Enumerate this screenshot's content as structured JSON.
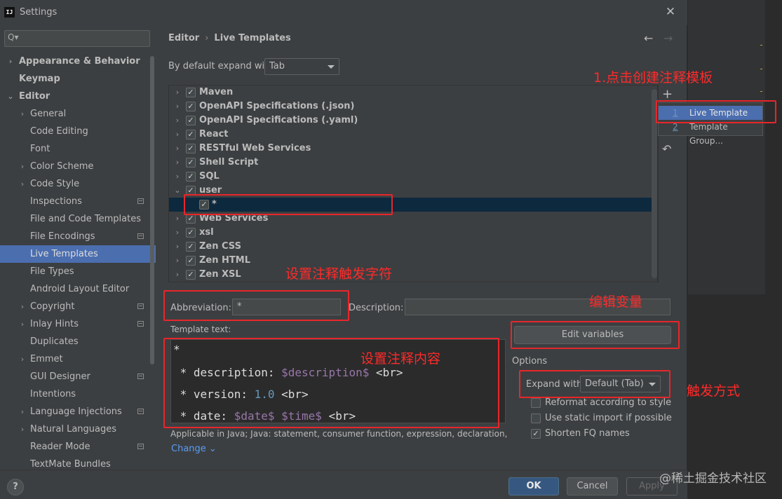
{
  "window": {
    "title": "Settings",
    "app_icon": "IJ"
  },
  "search": {
    "placeholder": ""
  },
  "sidebar": {
    "items": [
      {
        "label": "Appearance & Behavior"
      },
      {
        "label": "Keymap"
      },
      {
        "label": "Editor"
      },
      {
        "label": "General"
      },
      {
        "label": "Code Editing"
      },
      {
        "label": "Font"
      },
      {
        "label": "Color Scheme"
      },
      {
        "label": "Code Style"
      },
      {
        "label": "Inspections"
      },
      {
        "label": "File and Code Templates"
      },
      {
        "label": "File Encodings"
      },
      {
        "label": "Live Templates"
      },
      {
        "label": "File Types"
      },
      {
        "label": "Android Layout Editor"
      },
      {
        "label": "Copyright"
      },
      {
        "label": "Inlay Hints"
      },
      {
        "label": "Duplicates"
      },
      {
        "label": "Emmet"
      },
      {
        "label": "GUI Designer"
      },
      {
        "label": "Intentions"
      },
      {
        "label": "Language Injections"
      },
      {
        "label": "Natural Languages"
      },
      {
        "label": "Reader Mode"
      },
      {
        "label": "TextMate Bundles"
      }
    ],
    "selected": "Live Templates"
  },
  "breadcrumb": {
    "parent": "Editor",
    "separator": "›",
    "current": "Live Templates"
  },
  "nav": {
    "back": "←",
    "forward": "→"
  },
  "expand_default": {
    "label": "By default expand with",
    "value": "Tab"
  },
  "tree": {
    "groups": [
      {
        "label": "Maven",
        "checked": true
      },
      {
        "label": "OpenAPI Specifications (.json)",
        "checked": true
      },
      {
        "label": "OpenAPI Specifications (.yaml)",
        "checked": true
      },
      {
        "label": "React",
        "checked": true
      },
      {
        "label": "RESTful Web Services",
        "checked": true
      },
      {
        "label": "Shell Script",
        "checked": true
      },
      {
        "label": "SQL",
        "checked": true
      },
      {
        "label": "user",
        "checked": true
      },
      {
        "label": "*",
        "checked": true
      },
      {
        "label": "Web Services",
        "checked": true
      },
      {
        "label": "xsl",
        "checked": true
      },
      {
        "label": "Zen CSS",
        "checked": true
      },
      {
        "label": "Zen HTML",
        "checked": true
      },
      {
        "label": "Zen XSL",
        "checked": true
      }
    ]
  },
  "toolbar": {
    "add": "+",
    "restore": "↶"
  },
  "add_popup": {
    "items": [
      {
        "num": "1",
        "label": "Live Template"
      },
      {
        "num": "2",
        "label": "Template Group..."
      }
    ]
  },
  "form": {
    "abbreviation_label": "Abbreviation:",
    "abbreviation_value": "*",
    "description_label": "Description:",
    "description_value": "",
    "template_text_label": "Template text:",
    "edit_variables": "Edit variables",
    "options_label": "Options",
    "expand_with_label": "Expand with",
    "expand_with_value": "Default (Tab)"
  },
  "template_code": {
    "line1": "*",
    "line2_prefix": " * description: ",
    "line2_var": "$description$",
    "line2_suffix": " <br>",
    "line3_prefix": " * version: ",
    "line3_num": "1.0",
    "line3_suffix": " <br>",
    "line4_prefix": " * date: ",
    "line4_var1": "$date$",
    "line4_var2": "$time$",
    "line4_suffix": " <br>"
  },
  "options": [
    {
      "label": "Reformat according to style",
      "checked": false
    },
    {
      "label": "Use static import if possible",
      "checked": false
    },
    {
      "label": "Shorten FQ names",
      "checked": true
    }
  ],
  "applicable": {
    "text": "Applicable in Java; Java: statement, consumer function, expression, declaration, c...",
    "change": "Change"
  },
  "buttons": {
    "ok": "OK",
    "cancel": "Cancel",
    "apply": "Apply",
    "help": "?"
  },
  "annotations": {
    "create_template": "1.点击创建注释模板",
    "trigger_char": "设置注释触发字符",
    "edit_vars": "编辑变量",
    "content": "设置注释内容",
    "trigger_mode": "触发方式"
  },
  "watermark": "@稀土掘金技术社区",
  "colors": {
    "selection": "#4b6eaf",
    "annotation": "#e8262b",
    "link": "#589df6",
    "primary_button": "#365880"
  }
}
